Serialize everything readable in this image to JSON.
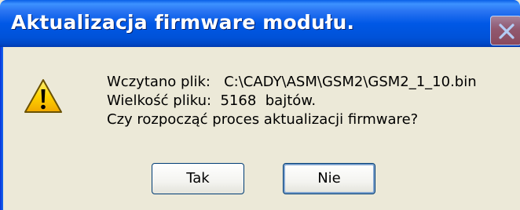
{
  "window": {
    "title": "Aktualizacja firmware modułu."
  },
  "icons": {
    "warning": "warning-icon",
    "close": "close-icon"
  },
  "message": {
    "line1": "Wczytano plik:   C:\\CADY\\ASM\\GSM2\\GSM2_1_10.bin",
    "line2": "Wielkość pliku:  5168  bajtów.",
    "line3": "Czy rozpocząć proces aktualizacji firmware?"
  },
  "buttons": {
    "yes_label": "Tak",
    "no_label": "Nie"
  },
  "colors": {
    "titlebar": "#0058e6",
    "dialog_bg": "#ece9d8",
    "title_text": "#ffffff",
    "warning_fill": "#ffd200"
  }
}
